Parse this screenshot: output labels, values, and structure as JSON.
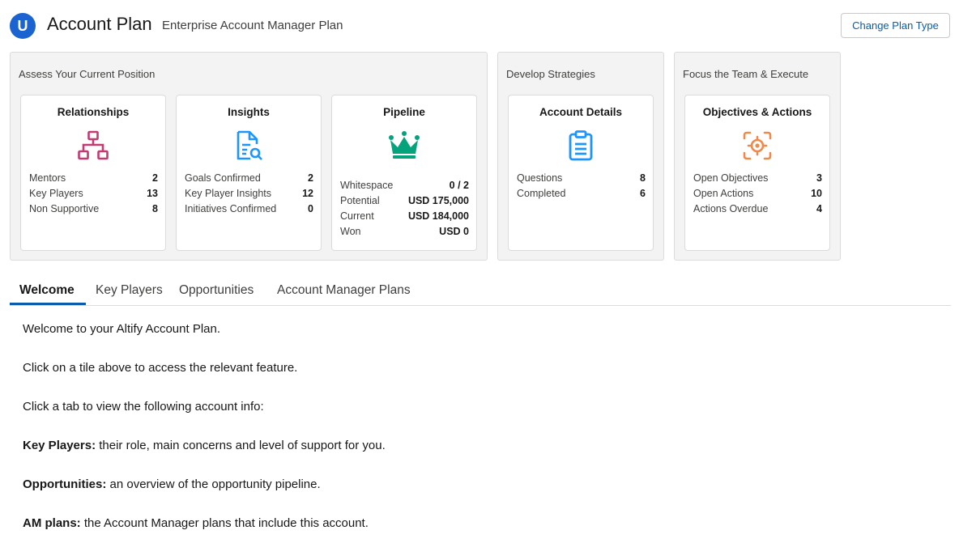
{
  "header": {
    "logo_letter": "U",
    "title": "Account Plan",
    "subtitle": "Enterprise Account Manager Plan",
    "change_button": "Change Plan Type"
  },
  "groups": [
    {
      "title": "Assess Your Current Position",
      "tiles": [
        {
          "title": "Relationships",
          "icon": "org-chart-icon",
          "color": "#c23b74",
          "stats": [
            {
              "label": "Mentors",
              "value": "2"
            },
            {
              "label": "Key Players",
              "value": "13"
            },
            {
              "label": "Non Supportive",
              "value": "8"
            }
          ]
        },
        {
          "title": "Insights",
          "icon": "document-search-icon",
          "color": "#1b96ff",
          "stats": [
            {
              "label": "Goals Confirmed",
              "value": "2"
            },
            {
              "label": "Key Player Insights",
              "value": "12"
            },
            {
              "label": "Initiatives Confirmed",
              "value": "0"
            }
          ]
        },
        {
          "title": "Pipeline",
          "icon": "crown-icon",
          "color": "#04a37c",
          "stats": [
            {
              "label": "Whitespace",
              "value": "0 / 2"
            },
            {
              "label": "Potential",
              "value": "USD 175,000"
            },
            {
              "label": "Current",
              "value": "USD 184,000"
            },
            {
              "label": "Won",
              "value": "USD 0"
            }
          ]
        }
      ]
    },
    {
      "title": "Develop Strategies",
      "tiles": [
        {
          "title": "Account Details",
          "icon": "clipboard-icon",
          "color": "#1b96ff",
          "stats": [
            {
              "label": "Questions",
              "value": "8"
            },
            {
              "label": "Completed",
              "value": "6"
            }
          ]
        }
      ]
    },
    {
      "title": "Focus the Team & Execute",
      "tiles": [
        {
          "title": "Objectives & Actions",
          "icon": "target-icon",
          "color": "#f08a4b",
          "stats": [
            {
              "label": "Open Objectives",
              "value": "3"
            },
            {
              "label": "Open Actions",
              "value": "10"
            },
            {
              "label": "Actions Overdue",
              "value": "4"
            }
          ]
        }
      ]
    }
  ],
  "tabs": [
    "Welcome",
    "Key Players",
    "Opportunities",
    "Account Manager Plans"
  ],
  "active_tab": "Welcome",
  "welcome": {
    "line1": "Welcome to your Altify Account Plan.",
    "line2": "Click on a tile above to access the relevant feature.",
    "line3": "Click a tab to view the following account info:",
    "items": [
      {
        "term": "Key Players:",
        "text": " their role, main concerns and level of support for you."
      },
      {
        "term": "Opportunities:",
        "text": " an overview of the opportunity pipeline."
      },
      {
        "term": "AM plans:",
        "text": " the Account Manager plans that include this account."
      }
    ]
  }
}
